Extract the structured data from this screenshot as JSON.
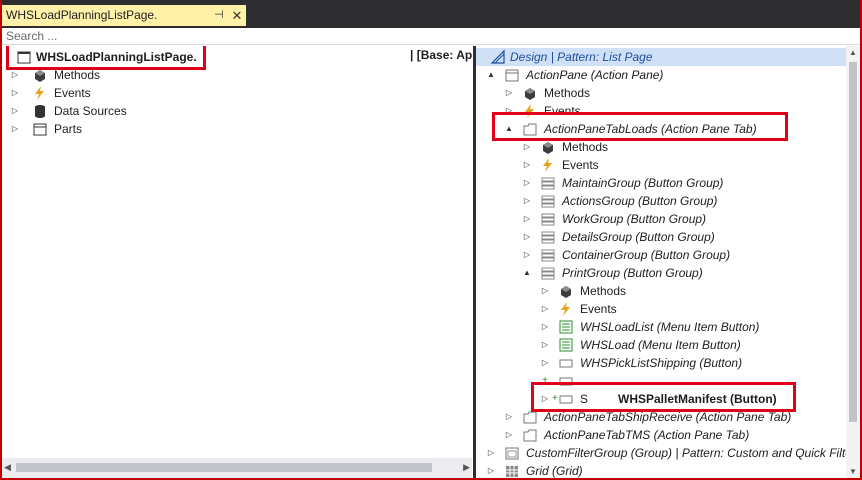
{
  "document_tab": {
    "title": "WHSLoadPlanningListPage.",
    "pin_glyph": "⊣",
    "close_glyph": "✕"
  },
  "search": {
    "placeholder": "Search ..."
  },
  "left_tree": {
    "root": "WHSLoadPlanningListPage.",
    "base_label": "| [Base: App",
    "items": [
      {
        "label": "Methods",
        "icon": "methods-icon"
      },
      {
        "label": "Events",
        "icon": "events-icon"
      },
      {
        "label": "Data Sources",
        "icon": "database-icon"
      },
      {
        "label": "Parts",
        "icon": "parts-icon"
      }
    ]
  },
  "right_tree": {
    "header": "Design | Pattern: List Page",
    "items": [
      {
        "label": "ActionPane (Action Pane)",
        "italic": true,
        "icon": "pane-icon",
        "arrow": "▲"
      },
      {
        "label": "Methods",
        "italic": false,
        "icon": "methods-icon",
        "arrow": "▷"
      },
      {
        "label": "Events",
        "italic": false,
        "icon": "events-icon",
        "arrow": "▷"
      },
      {
        "label": "ActionPaneTabLoads (Action Pane Tab)",
        "italic": true,
        "icon": "tab-icon",
        "arrow": "▲"
      },
      {
        "label": "Methods",
        "italic": false,
        "icon": "methods-icon",
        "arrow": "▷"
      },
      {
        "label": "Events",
        "italic": false,
        "icon": "events-icon",
        "arrow": "▷"
      },
      {
        "label": "MaintainGroup (Button Group)",
        "italic": true,
        "icon": "button-group-icon",
        "arrow": "▷"
      },
      {
        "label": "ActionsGroup (Button Group)",
        "italic": true,
        "icon": "button-group-icon",
        "arrow": "▷"
      },
      {
        "label": "WorkGroup (Button Group)",
        "italic": true,
        "icon": "button-group-icon",
        "arrow": "▷"
      },
      {
        "label": "DetailsGroup (Button Group)",
        "italic": true,
        "icon": "button-group-icon",
        "arrow": "▷"
      },
      {
        "label": "ContainerGroup (Button Group)",
        "italic": true,
        "icon": "button-group-icon",
        "arrow": "▷"
      },
      {
        "label": "PrintGroup (Button Group)",
        "italic": true,
        "icon": "button-group-icon",
        "arrow": "▲"
      },
      {
        "label": "Methods",
        "italic": false,
        "icon": "methods-icon",
        "arrow": "▷"
      },
      {
        "label": "Events",
        "italic": false,
        "icon": "events-icon",
        "arrow": "▷"
      },
      {
        "label": "WHSLoadList (Menu Item Button)",
        "italic": true,
        "icon": "menu-item-button-icon",
        "arrow": "▷"
      },
      {
        "label": "WHSLoad (Menu Item Button)",
        "italic": true,
        "icon": "menu-item-button-icon",
        "arrow": "▷"
      },
      {
        "label": "WHSPickListShipping (Button)",
        "italic": true,
        "icon": "button-icon",
        "arrow": "▷"
      },
      {
        "label": "",
        "italic": true,
        "icon": "button-icon",
        "arrow": "+"
      },
      {
        "label": "WHSPalletManifest (Button)",
        "italic": false,
        "bold": true,
        "icon": "button-icon",
        "arrow": "▷",
        "prefix": "S"
      },
      {
        "label": "ActionPaneTabShipReceive (Action Pane Tab)",
        "italic": true,
        "icon": "tab-icon",
        "arrow": "▷"
      },
      {
        "label": "ActionPaneTabTMS (Action Pane Tab)",
        "italic": true,
        "icon": "tab-icon",
        "arrow": "▷"
      },
      {
        "label": "CustomFilterGroup (Group) | Pattern: Custom and Quick Filters",
        "italic": true,
        "icon": "group-icon",
        "arrow": "▷"
      },
      {
        "label": "Grid (Grid)",
        "italic": true,
        "icon": "grid-icon",
        "arrow": "▷"
      }
    ]
  },
  "colors": {
    "highlight": "#e0001b",
    "tab_active": "#fff1a8",
    "chrome": "#2d2d30",
    "header_bg": "#cfe0f7",
    "header_text": "#1f4e9b",
    "event_icon": "#e8a317",
    "menu_item_icon": "#2e8b2e"
  }
}
